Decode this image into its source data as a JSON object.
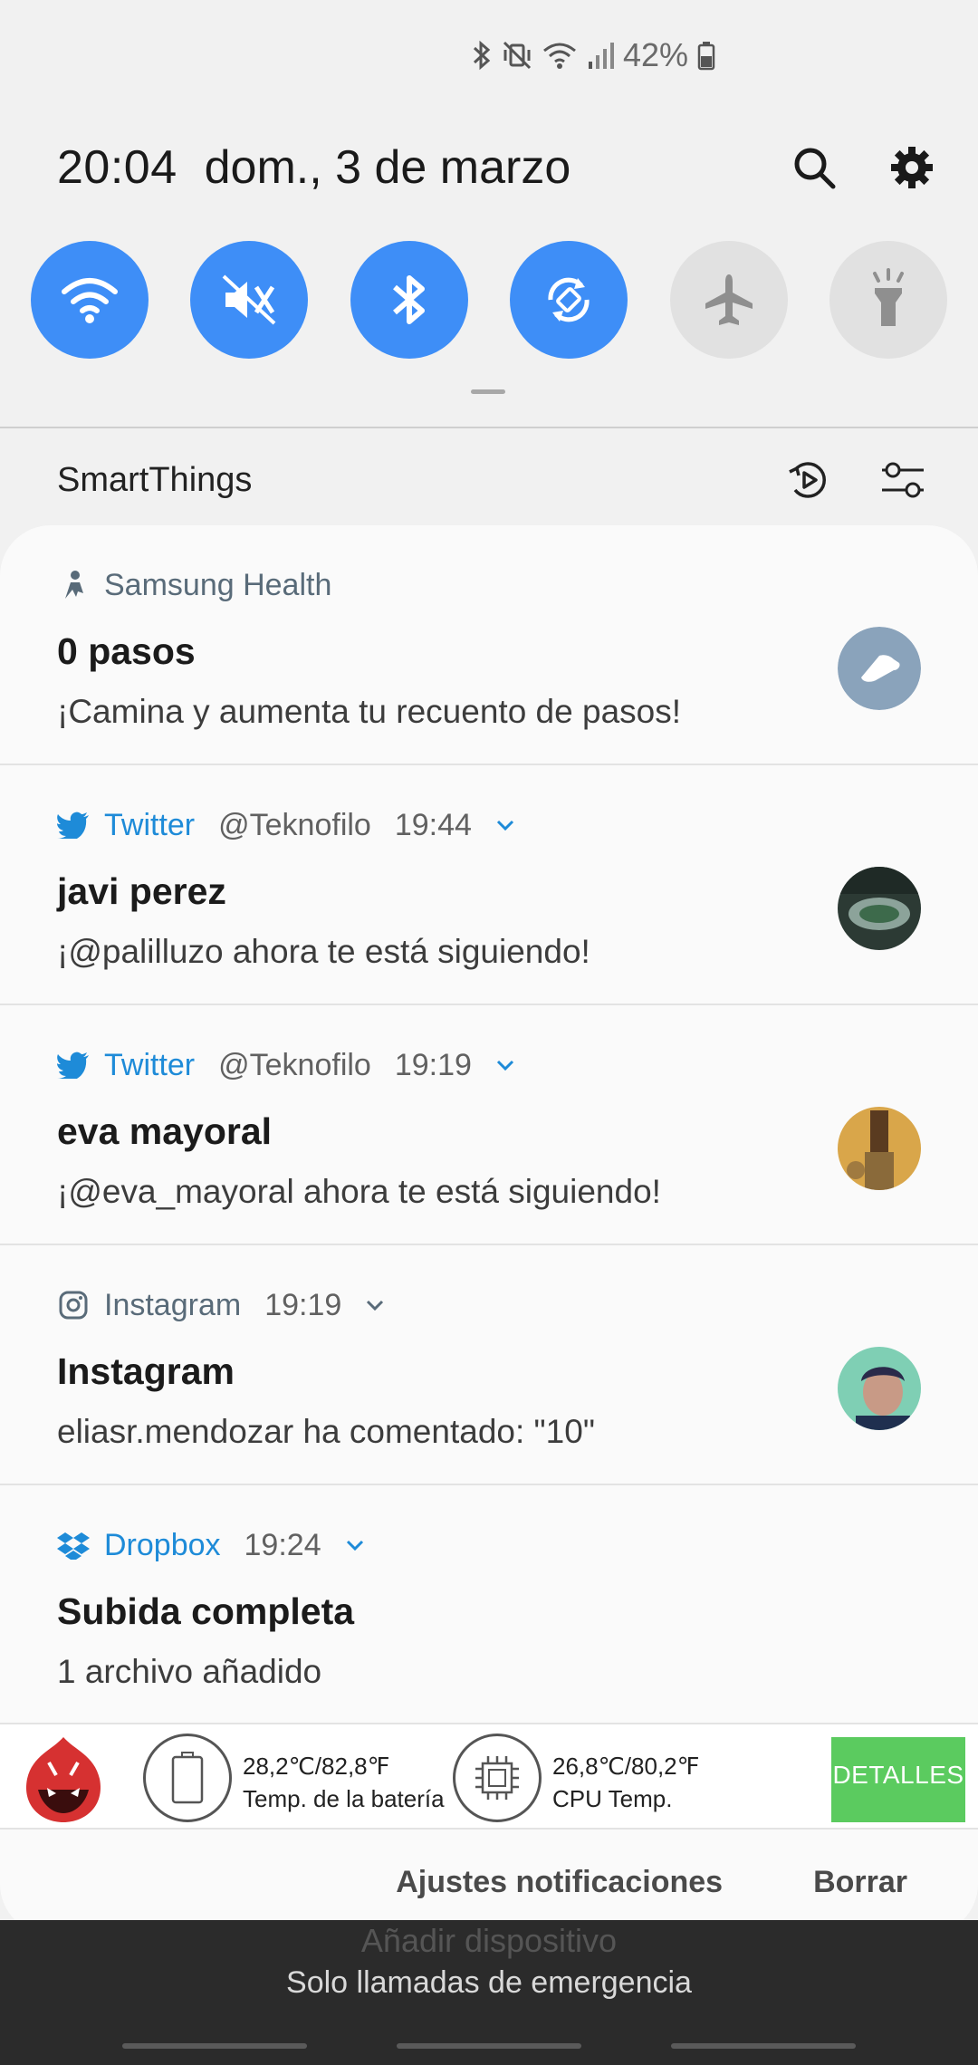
{
  "status_bar": {
    "battery_percent": "42%",
    "icons": [
      "bluetooth-icon",
      "vibrate-off-icon",
      "wifi-icon",
      "signal-icon",
      "battery-icon"
    ]
  },
  "header": {
    "time": "20:04",
    "date": "dom., 3 de marzo",
    "actions": [
      "search-icon",
      "gear-icon"
    ]
  },
  "quick_toggles": [
    {
      "name": "wifi",
      "state": "on",
      "icon": "wifi-icon"
    },
    {
      "name": "sound",
      "state": "on",
      "icon": "mute-icon"
    },
    {
      "name": "bluetooth",
      "state": "on",
      "icon": "bluetooth-icon"
    },
    {
      "name": "auto-rotate",
      "state": "on",
      "icon": "rotate-icon"
    },
    {
      "name": "airplane",
      "state": "off",
      "icon": "airplane-icon"
    },
    {
      "name": "flashlight",
      "state": "off",
      "icon": "flashlight-icon"
    }
  ],
  "smartthings": {
    "label": "SmartThings",
    "actions": [
      "media-output-icon",
      "settings-sliders-icon"
    ]
  },
  "notifications": [
    {
      "app": "Samsung Health",
      "title": "0 pasos",
      "text": "¡Camina y aumenta tu recuento de pasos!"
    },
    {
      "app": "Twitter",
      "account": "@Teknofilo",
      "time": "19:44",
      "title": "javi perez",
      "text": "¡@palilluzo ahora te está siguiendo!"
    },
    {
      "app": "Twitter",
      "account": "@Teknofilo",
      "time": "19:19",
      "title": "eva mayoral",
      "text": "¡@eva_mayoral ahora te está siguiendo!"
    },
    {
      "app": "Instagram",
      "time": "19:19",
      "title": "Instagram",
      "text": "eliasr.mendozar ha comentado: \"10\""
    },
    {
      "app": "Dropbox",
      "time": "19:24",
      "title": "Subida completa",
      "text": "1 archivo añadido"
    }
  ],
  "antutu": {
    "battery_temp": "28,2℃/82,8℉",
    "battery_label": "Temp. de la batería",
    "cpu_temp": "26,8℃/80,2℉",
    "cpu_label": "CPU Temp.",
    "details_button": "DETALLES"
  },
  "footer": {
    "settings_label": "Ajustes notificaciones",
    "clear_label": "Borrar"
  },
  "lockscreen": {
    "add_device": "Añadir dispositivo",
    "emergency": "Solo llamadas de emergencia"
  },
  "colors": {
    "toggle_on": "#3e8ef7",
    "toggle_off": "#e1e1e1",
    "twitter_blue": "#1e8bd8",
    "antutu_green": "#5bcb5f"
  }
}
